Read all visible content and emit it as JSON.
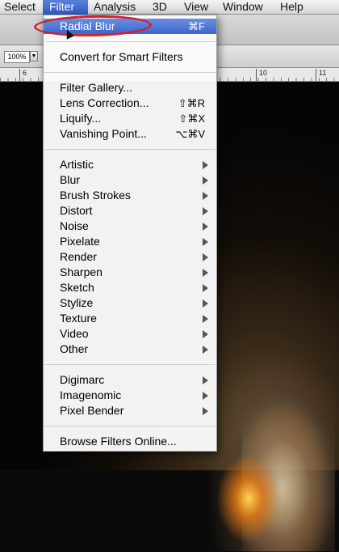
{
  "menubar": {
    "items": [
      "Select",
      "Filter",
      "Analysis",
      "3D",
      "View",
      "Window",
      "Help"
    ],
    "active": "Filter"
  },
  "options": {
    "zoom": "100%"
  },
  "ruler": {
    "marks": [
      "6",
      "10",
      "11"
    ]
  },
  "filter_menu": {
    "last_filter": {
      "label": "Radial Blur",
      "shortcut": "⌘F"
    },
    "smart_filters": "Convert for Smart Filters",
    "special": [
      {
        "label": "Filter Gallery...",
        "shortcut": ""
      },
      {
        "label": "Lens Correction...",
        "shortcut": "⇧⌘R"
      },
      {
        "label": "Liquify...",
        "shortcut": "⇧⌘X"
      },
      {
        "label": "Vanishing Point...",
        "shortcut": "⌥⌘V"
      }
    ],
    "categories": [
      "Artistic",
      "Blur",
      "Brush Strokes",
      "Distort",
      "Noise",
      "Pixelate",
      "Render",
      "Sharpen",
      "Sketch",
      "Stylize",
      "Texture",
      "Video",
      "Other"
    ],
    "plugins": [
      "Digimarc",
      "Imagenomic",
      "Pixel Bender"
    ],
    "browse": "Browse Filters Online..."
  },
  "colors": {
    "highlight": "#3a66cc",
    "annotation": "#d3202a"
  }
}
